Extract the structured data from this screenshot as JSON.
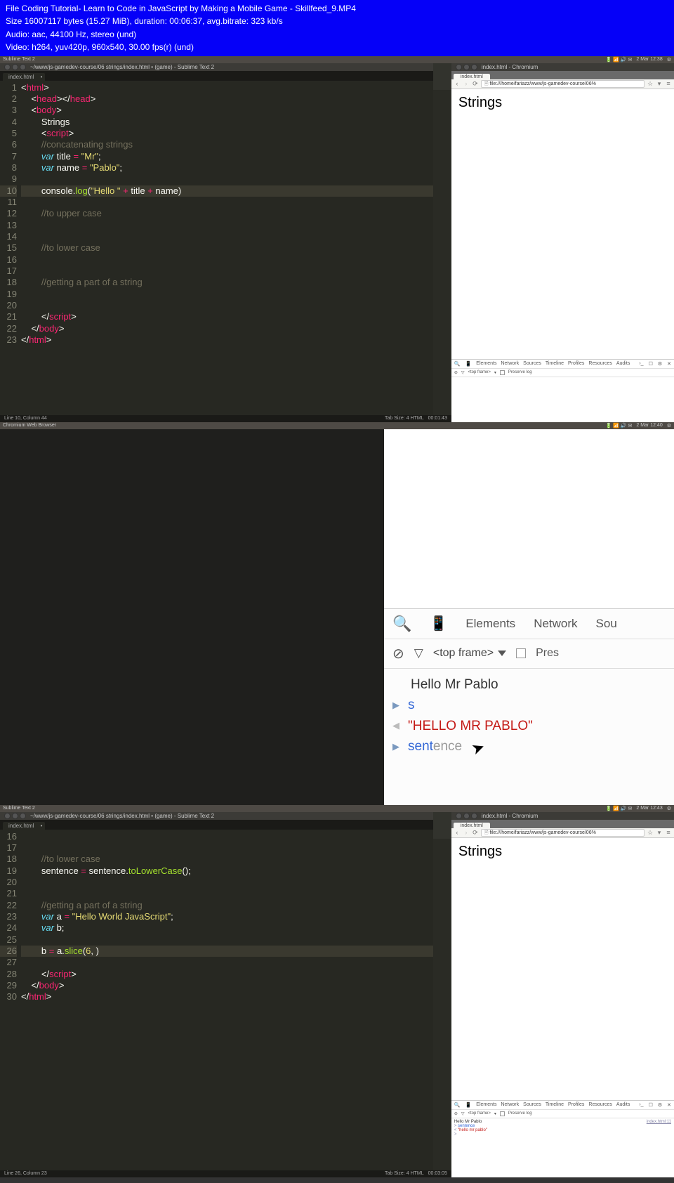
{
  "blue": {
    "line1": "File Coding Tutorial- Learn to Code in JavaScript by Making a Mobile Game - Skillfeed_9.MP4",
    "line2": "Size 16007117 bytes (15.27 MiB), duration: 00:06:37, avg.bitrate: 323 kb/s",
    "line3": "Audio: aac, 44100 Hz, stereo (und)",
    "line4": "Video: h264, yuv420p, 960x540, 30.00 fps(r) (und)"
  },
  "topbar1": {
    "app": "Sublime Text 2",
    "time": "2 Mar 12:38"
  },
  "topbar2": {
    "app": "Chromium Web Browser",
    "time": "2 Mar 12:40"
  },
  "topbar3": {
    "app": "Sublime Text 2",
    "time": "2 Mar 12:43"
  },
  "sublime": {
    "title": "~/www/js-gamedev-course/06 strings/index.html • (game) - Sublime Text 2",
    "tab": "index.html",
    "status_left_1": "Line 10, Column 44",
    "status_left_3": "Line 26, Column 23",
    "status_right": "Tab Size: 4     HTML",
    "time_bottom_1": "00:01:43",
    "time_bottom_3": "00:03:05"
  },
  "code1": {
    "lines": [
      {
        "n": 1,
        "seg": [
          [
            "br",
            "<"
          ],
          [
            "tag",
            "html"
          ],
          [
            "br",
            ">"
          ]
        ]
      },
      {
        "n": 2,
        "seg": [
          [
            "ind",
            "    "
          ],
          [
            "br",
            "<"
          ],
          [
            "tag",
            "head"
          ],
          [
            "br",
            "></"
          ],
          [
            "tag",
            "head"
          ],
          [
            "br",
            ">"
          ]
        ]
      },
      {
        "n": 3,
        "seg": [
          [
            "ind",
            "    "
          ],
          [
            "br",
            "<"
          ],
          [
            "tag",
            "body"
          ],
          [
            "br",
            ">"
          ]
        ]
      },
      {
        "n": 4,
        "seg": [
          [
            "ind",
            "        "
          ],
          [
            "pl",
            "Strings"
          ]
        ]
      },
      {
        "n": 5,
        "seg": [
          [
            "ind",
            "        "
          ],
          [
            "br",
            "<"
          ],
          [
            "tag",
            "script"
          ],
          [
            "br",
            ">"
          ]
        ]
      },
      {
        "n": 6,
        "seg": [
          [
            "ind",
            "        "
          ],
          [
            "com",
            "//concatenating strings"
          ]
        ]
      },
      {
        "n": 7,
        "seg": [
          [
            "ind",
            "        "
          ],
          [
            "var",
            "var"
          ],
          [
            "pl",
            " title "
          ],
          [
            "decl",
            "="
          ],
          [
            "pl",
            " "
          ],
          [
            "str",
            "\"Mr\""
          ],
          [
            "pl",
            ";"
          ]
        ]
      },
      {
        "n": 8,
        "seg": [
          [
            "ind",
            "        "
          ],
          [
            "var",
            "var"
          ],
          [
            "pl",
            " name "
          ],
          [
            "decl",
            "="
          ],
          [
            "pl",
            " "
          ],
          [
            "str",
            "\"Pablo\""
          ],
          [
            "pl",
            ";"
          ]
        ]
      },
      {
        "n": 9,
        "seg": []
      },
      {
        "n": 10,
        "hl": true,
        "seg": [
          [
            "ind",
            "        "
          ],
          [
            "pl",
            "console."
          ],
          [
            "nm",
            "log"
          ],
          [
            "pl",
            "("
          ],
          [
            "str",
            "\"Hello \""
          ],
          [
            "pl",
            " "
          ],
          [
            "decl",
            "+"
          ],
          [
            "pl",
            " title "
          ],
          [
            "decl",
            "+"
          ],
          [
            "pl",
            " name)"
          ]
        ]
      },
      {
        "n": 11,
        "seg": []
      },
      {
        "n": 12,
        "seg": [
          [
            "ind",
            "        "
          ],
          [
            "com",
            "//to upper case"
          ]
        ]
      },
      {
        "n": 13,
        "seg": []
      },
      {
        "n": 14,
        "seg": []
      },
      {
        "n": 15,
        "seg": [
          [
            "ind",
            "        "
          ],
          [
            "com",
            "//to lower case"
          ]
        ]
      },
      {
        "n": 16,
        "seg": []
      },
      {
        "n": 17,
        "seg": []
      },
      {
        "n": 18,
        "seg": [
          [
            "ind",
            "        "
          ],
          [
            "com",
            "//getting a part of a string"
          ]
        ]
      },
      {
        "n": 19,
        "seg": []
      },
      {
        "n": 20,
        "seg": []
      },
      {
        "n": 21,
        "seg": [
          [
            "ind",
            "        "
          ],
          [
            "br",
            "</"
          ],
          [
            "tag",
            "script"
          ],
          [
            "br",
            ">"
          ]
        ]
      },
      {
        "n": 22,
        "seg": [
          [
            "ind",
            "    "
          ],
          [
            "br",
            "</"
          ],
          [
            "tag",
            "body"
          ],
          [
            "br",
            ">"
          ]
        ]
      },
      {
        "n": 23,
        "seg": [
          [
            "br",
            "</"
          ],
          [
            "tag",
            "html"
          ],
          [
            "br",
            ">"
          ]
        ]
      }
    ]
  },
  "code3": {
    "lines": [
      {
        "n": 16,
        "seg": []
      },
      {
        "n": 17,
        "seg": []
      },
      {
        "n": 18,
        "seg": [
          [
            "ind",
            "        "
          ],
          [
            "com",
            "//to lower case"
          ]
        ]
      },
      {
        "n": 19,
        "seg": [
          [
            "ind",
            "        "
          ],
          [
            "pl",
            "sentence "
          ],
          [
            "decl",
            "="
          ],
          [
            "pl",
            " sentence."
          ],
          [
            "nm",
            "toLowerCase"
          ],
          [
            "pl",
            "();"
          ]
        ]
      },
      {
        "n": 20,
        "seg": []
      },
      {
        "n": 21,
        "seg": []
      },
      {
        "n": 22,
        "seg": [
          [
            "ind",
            "        "
          ],
          [
            "com",
            "//getting a part of a string"
          ]
        ]
      },
      {
        "n": 23,
        "seg": [
          [
            "ind",
            "        "
          ],
          [
            "var",
            "var"
          ],
          [
            "pl",
            " a "
          ],
          [
            "decl",
            "="
          ],
          [
            "pl",
            " "
          ],
          [
            "str",
            "\"Hello World JavaScript\""
          ],
          [
            "pl",
            ";"
          ]
        ]
      },
      {
        "n": 24,
        "seg": [
          [
            "ind",
            "        "
          ],
          [
            "var",
            "var"
          ],
          [
            "pl",
            " b;"
          ]
        ]
      },
      {
        "n": 25,
        "seg": []
      },
      {
        "n": 26,
        "hl": true,
        "seg": [
          [
            "ind",
            "        "
          ],
          [
            "pl",
            "b "
          ],
          [
            "decl",
            "="
          ],
          [
            "pl",
            " a."
          ],
          [
            "nm",
            "slice"
          ],
          [
            "pl",
            "("
          ],
          [
            "str",
            "6"
          ],
          [
            "pl",
            ", )"
          ]
        ]
      },
      {
        "n": 27,
        "seg": []
      },
      {
        "n": 28,
        "seg": [
          [
            "ind",
            "        "
          ],
          [
            "br",
            "</"
          ],
          [
            "tag",
            "script"
          ],
          [
            "br",
            ">"
          ]
        ]
      },
      {
        "n": 29,
        "seg": [
          [
            "ind",
            "    "
          ],
          [
            "br",
            "</"
          ],
          [
            "tag",
            "body"
          ],
          [
            "br",
            ">"
          ]
        ]
      },
      {
        "n": 30,
        "seg": [
          [
            "br",
            "</"
          ],
          [
            "tag",
            "html"
          ],
          [
            "br",
            ">"
          ]
        ]
      }
    ]
  },
  "chrome": {
    "title": "index.html - Chromium",
    "tab": "index.html",
    "url": "file:///home/fariazz/www/js-gamedev-course/06%",
    "heading": "Strings"
  },
  "devtools_small": {
    "tabs": [
      "Elements",
      "Network",
      "Sources",
      "Timeline",
      "Profiles",
      "Resources",
      "Audits"
    ],
    "frame": "<top frame>",
    "preserve": "Preserve log"
  },
  "devtools_small3": {
    "lines": [
      {
        "text": "Hello Mr Pablo",
        "prompt": "  "
      },
      {
        "text": "sentence",
        "prompt": "> ",
        "cls": "conblue"
      },
      {
        "text": "\"hello mr pablo\"",
        "prompt": "< ",
        "cls": "conred"
      },
      {
        "text": "",
        "prompt": "> "
      }
    ],
    "rightref": "index.html:11"
  },
  "bigdt": {
    "tabs": [
      "Elements",
      "Network",
      "Sou"
    ],
    "frame": "<top frame>",
    "preserve": "Pres",
    "lines": [
      {
        "prompt": "  ",
        "text": "Hello Mr Pablo",
        "cls": "conblack"
      },
      {
        "prompt": "› ",
        "text": "s",
        "cls": "conblue"
      },
      {
        "prompt": "‹ ",
        "text": "\"HELLO MR PABLO\"",
        "cls": "conred"
      },
      {
        "prompt": "› ",
        "text": "sent",
        "tail": "ence",
        "cls": "conblue"
      }
    ]
  }
}
